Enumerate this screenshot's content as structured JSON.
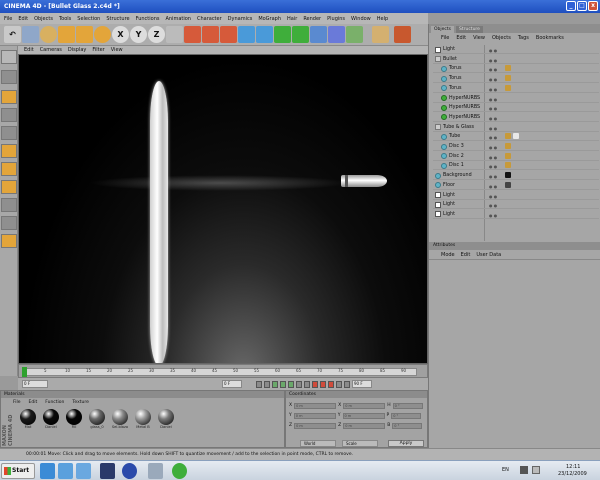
{
  "window": {
    "title": "CINEMA 4D - [Bullet Glass 2.c4d *]",
    "btn_min": "_",
    "btn_max": "□",
    "btn_close": "x"
  },
  "menu": [
    "File",
    "Edit",
    "Objects",
    "Tools",
    "Selection",
    "Structure",
    "Functions",
    "Animation",
    "Character",
    "Dynamics",
    "MoGraph",
    "Hair",
    "Render",
    "Plugins",
    "Window",
    "Help"
  ],
  "toolbar": {
    "undo": "↶",
    "x_label": "X",
    "y_label": "Y",
    "z_label": "Z"
  },
  "viewport_menu": [
    "Edit",
    "Cameras",
    "Display",
    "Filter",
    "View"
  ],
  "timeline": {
    "ticks": [
      "0",
      "5",
      "10",
      "15",
      "20",
      "25",
      "30",
      "35",
      "40",
      "45",
      "50",
      "55",
      "60",
      "65",
      "70",
      "75",
      "80",
      "85",
      "90"
    ],
    "end_frame": "0 F",
    "current_frame": "0 F",
    "max_frame": "90 F"
  },
  "materials": {
    "header": "Materials",
    "menu": [
      "File",
      "Edit",
      "Function",
      "Texture"
    ],
    "items": [
      {
        "label": "Mat",
        "color": "#1a1a1a"
      },
      {
        "label": "Daniel",
        "color": "#0a0a0a"
      },
      {
        "label": "Fill",
        "color": "#050505"
      },
      {
        "label": "glass_0",
        "color": "#6a6a6a"
      },
      {
        "label": "Sel.blazo",
        "color": "#8a8a8a"
      },
      {
        "label": "Metal B",
        "color": "#9a9a9a"
      },
      {
        "label": "Daniel",
        "color": "#7a7a7a"
      }
    ],
    "logo": "MAXON CINEMA 4D"
  },
  "coordinates": {
    "header": "Coordinates",
    "rows": [
      {
        "axis": "X",
        "pos": "0 m",
        "size": "0 m",
        "rot_label": "H",
        "rot": "0 °"
      },
      {
        "axis": "Y",
        "pos": "0 m",
        "size": "0 m",
        "rot_label": "P",
        "rot": "0 °"
      },
      {
        "axis": "Z",
        "pos": "0 m",
        "size": "0 m",
        "rot_label": "B",
        "rot": "0 °"
      }
    ],
    "mode1": "World",
    "mode2": "Scale",
    "apply": "Apply"
  },
  "status": "00:00:01 Move: Click and drag to move elements. Hold down SHIFT to quantize movement / add to the selection in point mode, CTRL to remove.",
  "objects_panel": {
    "tabs": [
      "Objects",
      "Structure"
    ],
    "menu": [
      "File",
      "Edit",
      "View",
      "Objects",
      "Tags",
      "Bookmarks"
    ],
    "rows": [
      {
        "name": "Light",
        "icon": "light",
        "indent": 0,
        "tags": []
      },
      {
        "name": "Bullet",
        "icon": "null",
        "indent": 0,
        "tags": []
      },
      {
        "name": "Torus",
        "icon": "torus",
        "indent": 1,
        "tags": [
          "#c79a3a"
        ]
      },
      {
        "name": "Torus",
        "icon": "torus",
        "indent": 1,
        "tags": [
          "#c79a3a"
        ]
      },
      {
        "name": "Torus",
        "icon": "torus",
        "indent": 1,
        "tags": [
          "#c79a3a"
        ]
      },
      {
        "name": "HyperNURBS",
        "icon": "hn",
        "indent": 1,
        "tags": []
      },
      {
        "name": "HyperNURBS",
        "icon": "hn",
        "indent": 1,
        "tags": []
      },
      {
        "name": "HyperNURBS",
        "icon": "hn",
        "indent": 1,
        "tags": []
      },
      {
        "name": "Tube & Glass",
        "icon": "null",
        "indent": 0,
        "tags": []
      },
      {
        "name": "Tube",
        "icon": "torus",
        "indent": 1,
        "tags": [
          "#c79a3a",
          "#e8e8e8"
        ]
      },
      {
        "name": "Disc 3",
        "icon": "torus",
        "indent": 1,
        "tags": [
          "#c79a3a"
        ]
      },
      {
        "name": "Disc 2",
        "icon": "torus",
        "indent": 1,
        "tags": [
          "#c79a3a"
        ]
      },
      {
        "name": "Disc 1",
        "icon": "torus",
        "indent": 1,
        "tags": [
          "#c79a3a"
        ]
      },
      {
        "name": "Background",
        "icon": "torus",
        "indent": 0,
        "tags": [
          "#111111"
        ]
      },
      {
        "name": "Floor",
        "icon": "torus",
        "indent": 0,
        "tags": [
          "#444444"
        ]
      },
      {
        "name": "Light",
        "icon": "light",
        "indent": 0,
        "tags": []
      },
      {
        "name": "Light",
        "icon": "light",
        "indent": 0,
        "tags": []
      },
      {
        "name": "Light",
        "icon": "light",
        "indent": 0,
        "tags": []
      }
    ]
  },
  "attributes": {
    "header": "Attributes",
    "menu": [
      "Mode",
      "Edit",
      "User Data"
    ]
  },
  "taskbar": {
    "start": "Start",
    "lang": "EN",
    "time": "12:11",
    "date": "23/12/2009"
  }
}
